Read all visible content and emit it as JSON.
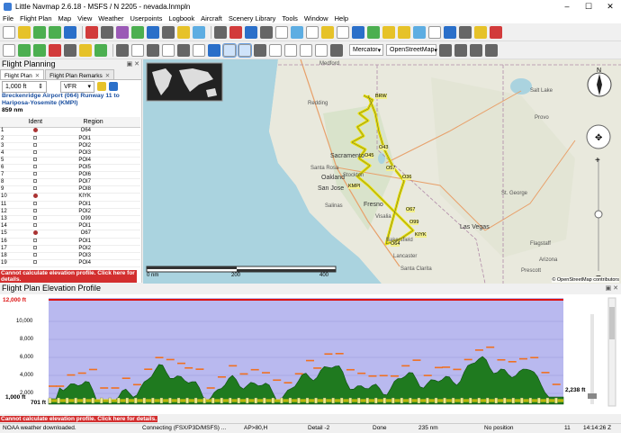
{
  "window": {
    "title": "Little Navmap 2.6.18 - MSFS / N 2205 - nevada.lnmpln"
  },
  "menu": [
    "File",
    "Flight Plan",
    "Map",
    "View",
    "Weather",
    "Userpoints",
    "Logbook",
    "Aircraft",
    "Scenery Library",
    "Tools",
    "Window",
    "Help"
  ],
  "toolbar": {
    "projection": "Mercator",
    "theme": "OpenStreetMap"
  },
  "flight_planning": {
    "title": "Flight Planning",
    "tabs": [
      "Flight Plan",
      "Flight Plan Remarks"
    ],
    "altitude": "1,000 ft",
    "rules": "VFR",
    "route_description": "Breckenridge Airport (064) Runway 11 to Hariposa-Yosemite (KMPI)",
    "distance": "859 nm",
    "columns": [
      "Ident",
      "Region"
    ],
    "rows": [
      {
        "n": "1",
        "sym": "ap",
        "ident": "O64"
      },
      {
        "n": "2",
        "sym": "box",
        "ident": "POI1"
      },
      {
        "n": "3",
        "sym": "box",
        "ident": "POI2"
      },
      {
        "n": "4",
        "sym": "box",
        "ident": "POI3"
      },
      {
        "n": "5",
        "sym": "box",
        "ident": "POI4"
      },
      {
        "n": "6",
        "sym": "box",
        "ident": "POI5"
      },
      {
        "n": "7",
        "sym": "box",
        "ident": "POI6"
      },
      {
        "n": "8",
        "sym": "box",
        "ident": "POI7"
      },
      {
        "n": "9",
        "sym": "box",
        "ident": "POI8"
      },
      {
        "n": "10",
        "sym": "ap",
        "ident": "KIYK"
      },
      {
        "n": "11",
        "sym": "box",
        "ident": "POI1"
      },
      {
        "n": "12",
        "sym": "box",
        "ident": "POI2"
      },
      {
        "n": "13",
        "sym": "box",
        "ident": "O99"
      },
      {
        "n": "14",
        "sym": "box",
        "ident": "POI1"
      },
      {
        "n": "15",
        "sym": "ap",
        "ident": "O67"
      },
      {
        "n": "16",
        "sym": "box",
        "ident": "POI1"
      },
      {
        "n": "17",
        "sym": "box",
        "ident": "POI2"
      },
      {
        "n": "18",
        "sym": "box",
        "ident": "POI3"
      },
      {
        "n": "19",
        "sym": "box",
        "ident": "POI4"
      }
    ],
    "error": "Cannot calculate elevation profile. Click here for details."
  },
  "map": {
    "scale_labels": [
      "0 nm",
      "200",
      "400"
    ],
    "attribution": "© OpenStreetMap contributors",
    "cities": [
      {
        "name": "Medford"
      },
      {
        "name": "Redding"
      },
      {
        "name": "Sacramento"
      },
      {
        "name": "Santa Rosa"
      },
      {
        "name": "Oakland"
      },
      {
        "name": "San Jose"
      },
      {
        "name": "Stockton"
      },
      {
        "name": "Salinas"
      },
      {
        "name": "Fresno"
      },
      {
        "name": "Visalia"
      },
      {
        "name": "Bakersfield"
      },
      {
        "name": "Las Vegas"
      },
      {
        "name": "Salt Lake"
      },
      {
        "name": "Provo"
      },
      {
        "name": "St. George"
      },
      {
        "name": "Flagstaff"
      },
      {
        "name": "Lancaster"
      },
      {
        "name": "Santa Clarita"
      },
      {
        "name": "Arizona"
      },
      {
        "name": "Prescott"
      }
    ],
    "route_labels": [
      "BRW",
      "O43",
      "KMPI",
      "O45",
      "O67",
      "O99",
      "KIYK",
      "O64",
      "O57",
      "O36"
    ]
  },
  "profile": {
    "title": "Flight Plan Elevation Profile",
    "max_alt_label": "12,000 ft",
    "y_ticks": [
      "10,000",
      "8,000",
      "6,000",
      "4,000",
      "2,000"
    ],
    "cruise_label": "1,000 ft",
    "start_label": "701 ft",
    "end_label": "2,238 ft",
    "error": "Cannot calculate elevation profile. Click here for details."
  },
  "status": {
    "left": "NOAA weather downloaded.",
    "connection": "Connecting (FSX/P3D/MSFS) ...",
    "ap": "AP>80,H",
    "detail": "Detail -2",
    "done": "Done",
    "distance": "235 nm",
    "position": "No position",
    "count": "11",
    "time": "14:14:26 Z"
  },
  "colors": {
    "terrain": "#1f7a1f",
    "sky": "#b9b9ef",
    "route": "#e8e000",
    "max": "#d11"
  }
}
